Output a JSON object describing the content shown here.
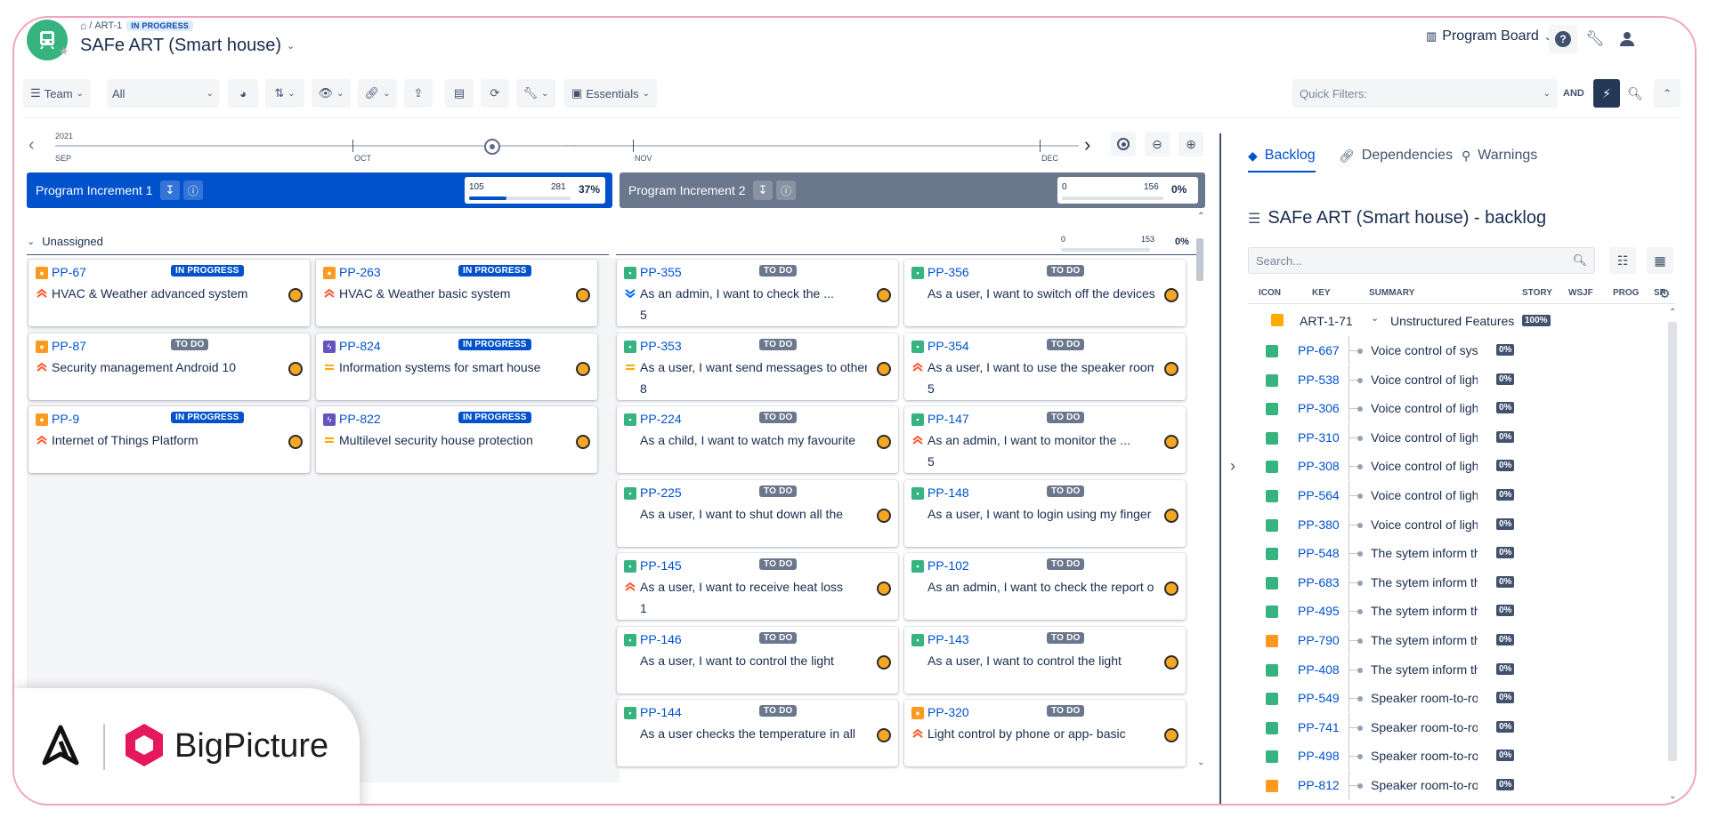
{
  "breadcrumb": {
    "sep": "/",
    "key": "ART-1",
    "status": "IN PROGRESS"
  },
  "page": {
    "title": "SAFe ART (Smart house)"
  },
  "header": {
    "board_label": "Program Board"
  },
  "toolbar": {
    "team_label": "Team",
    "filter_value": "All",
    "essentials_label": "Essentials"
  },
  "quick_filters": {
    "placeholder": "Quick Filters:",
    "and_label": "AND"
  },
  "timeline": {
    "year": "2021",
    "months": [
      "SEP",
      "OCT",
      "NOV",
      "DEC"
    ]
  },
  "increments": [
    {
      "name": "Program Increment 1",
      "done": "105",
      "total": "281",
      "percent": "37%",
      "progress": 0.37
    },
    {
      "name": "Program Increment 2",
      "done": "0",
      "total": "156",
      "percent": "0%",
      "progress": 0
    }
  ],
  "swimlane": {
    "name": "Unassigned",
    "done": "0",
    "total": "153",
    "percent": "0%"
  },
  "cards": [
    {
      "key": "PP-67",
      "status": "IN PROGRESS",
      "summary": "HVAC & Weather advanced system",
      "type": "feature",
      "priority": "high",
      "points": ""
    },
    {
      "key": "PP-263",
      "status": "IN PROGRESS",
      "summary": "HVAC & Weather basic system",
      "type": "feature",
      "priority": "high",
      "points": ""
    },
    {
      "key": "PP-355",
      "status": "TO DO",
      "summary": "As an admin, I want to check the ...",
      "type": "story",
      "priority": "low",
      "points": "5"
    },
    {
      "key": "PP-356",
      "status": "TO DO",
      "summary": "As a user, I want to switch off the devices",
      "type": "story",
      "priority": "none",
      "points": ""
    },
    {
      "key": "PP-87",
      "status": "TO DO",
      "summary": "Security management Android 10",
      "type": "feature",
      "priority": "high",
      "points": ""
    },
    {
      "key": "PP-824",
      "status": "IN PROGRESS",
      "summary": "Information systems for smart house",
      "type": "epic",
      "priority": "medium",
      "points": ""
    },
    {
      "key": "PP-353",
      "status": "TO DO",
      "summary": "As a user, I want send messages to other",
      "type": "story",
      "priority": "medium",
      "points": "8"
    },
    {
      "key": "PP-354",
      "status": "TO DO",
      "summary": "As a user, I want to use the speaker room-",
      "type": "story",
      "priority": "high",
      "points": "5"
    },
    {
      "key": "PP-9",
      "status": "IN PROGRESS",
      "summary": "Internet of Things Platform",
      "type": "feature",
      "priority": "high",
      "points": ""
    },
    {
      "key": "PP-822",
      "status": "IN PROGRESS",
      "summary": "Multilevel security house protection",
      "type": "epic",
      "priority": "medium",
      "points": ""
    },
    {
      "key": "PP-224",
      "status": "TO DO",
      "summary": "As a child, I want to watch my favourite",
      "type": "story",
      "priority": "none",
      "points": ""
    },
    {
      "key": "PP-147",
      "status": "TO DO",
      "summary": "As an admin, I want to monitor the ...",
      "type": "story",
      "priority": "high",
      "points": "5"
    },
    {
      "key": "PP-225",
      "status": "TO DO",
      "summary": "As a user, I want to shut down all the",
      "type": "story",
      "priority": "none",
      "points": ""
    },
    {
      "key": "PP-148",
      "status": "TO DO",
      "summary": "As a user, I want to login using my finger",
      "type": "story",
      "priority": "none",
      "points": ""
    },
    {
      "key": "PP-145",
      "status": "TO DO",
      "summary": "As a user, I want to receive heat loss",
      "type": "story",
      "priority": "high",
      "points": "1"
    },
    {
      "key": "PP-102",
      "status": "TO DO",
      "summary": "As an admin, I want to check the report of",
      "type": "story",
      "priority": "none",
      "points": ""
    },
    {
      "key": "PP-146",
      "status": "TO DO",
      "summary": "As a user, I want to control the light",
      "type": "story",
      "priority": "none",
      "points": ""
    },
    {
      "key": "PP-143",
      "status": "TO DO",
      "summary": "As a user, I want to control the light",
      "type": "story",
      "priority": "none",
      "points": ""
    },
    {
      "key": "PP-144",
      "status": "TO DO",
      "summary": "As a user checks the temperature in all",
      "type": "story",
      "priority": "none",
      "points": ""
    },
    {
      "key": "PP-320",
      "status": "TO DO",
      "summary": "Light control by phone or app- basic",
      "type": "feature",
      "priority": "high",
      "points": ""
    }
  ],
  "panel": {
    "tabs": [
      "Backlog",
      "Dependencies",
      "Warnings"
    ],
    "title": "SAFe ART (Smart house) - backlog",
    "search_placeholder": "Search...",
    "columns": [
      "ICON",
      "KEY",
      "SUMMARY",
      "STORY",
      "WSJF",
      "PROG",
      "SP"
    ],
    "group": {
      "key": "ART-1-71",
      "summary": "Unstructured Features",
      "percent": "100%"
    },
    "rows": [
      {
        "key": "PP-667",
        "summary": "Voice control of sys",
        "percent": "0%",
        "type": "story"
      },
      {
        "key": "PP-538",
        "summary": "Voice control of ligh",
        "percent": "0%",
        "type": "story"
      },
      {
        "key": "PP-306",
        "summary": "Voice control of ligh",
        "percent": "0%",
        "type": "story"
      },
      {
        "key": "PP-310",
        "summary": "Voice control of ligh",
        "percent": "0%",
        "type": "story"
      },
      {
        "key": "PP-308",
        "summary": "Voice control of ligh",
        "percent": "0%",
        "type": "story"
      },
      {
        "key": "PP-564",
        "summary": "Voice control of ligh",
        "percent": "0%",
        "type": "story"
      },
      {
        "key": "PP-380",
        "summary": "Voice control of ligh",
        "percent": "0%",
        "type": "story"
      },
      {
        "key": "PP-548",
        "summary": "The sytem inform th",
        "percent": "0%",
        "type": "story"
      },
      {
        "key": "PP-683",
        "summary": "The sytem inform th",
        "percent": "0%",
        "type": "story"
      },
      {
        "key": "PP-495",
        "summary": "The sytem inform th",
        "percent": "0%",
        "type": "story"
      },
      {
        "key": "PP-790",
        "summary": "The sytem inform th",
        "percent": "0%",
        "type": "feature"
      },
      {
        "key": "PP-408",
        "summary": "The sytem inform th",
        "percent": "0%",
        "type": "story"
      },
      {
        "key": "PP-549",
        "summary": "Speaker room-to-ro",
        "percent": "0%",
        "type": "story"
      },
      {
        "key": "PP-741",
        "summary": "Speaker room-to-ro",
        "percent": "0%",
        "type": "story"
      },
      {
        "key": "PP-498",
        "summary": "Speaker room-to-ro",
        "percent": "0%",
        "type": "story"
      },
      {
        "key": "PP-812",
        "summary": "Speaker room-to-ro",
        "percent": "0%",
        "type": "feature"
      }
    ]
  },
  "branding": {
    "name": "BigPicture"
  },
  "colors": {
    "accent": "#0052cc",
    "pi2": "#6b778c",
    "story": "#36b37e",
    "feature": "#ff991f",
    "epic": "#6554c0",
    "brand": "#e5185d"
  }
}
